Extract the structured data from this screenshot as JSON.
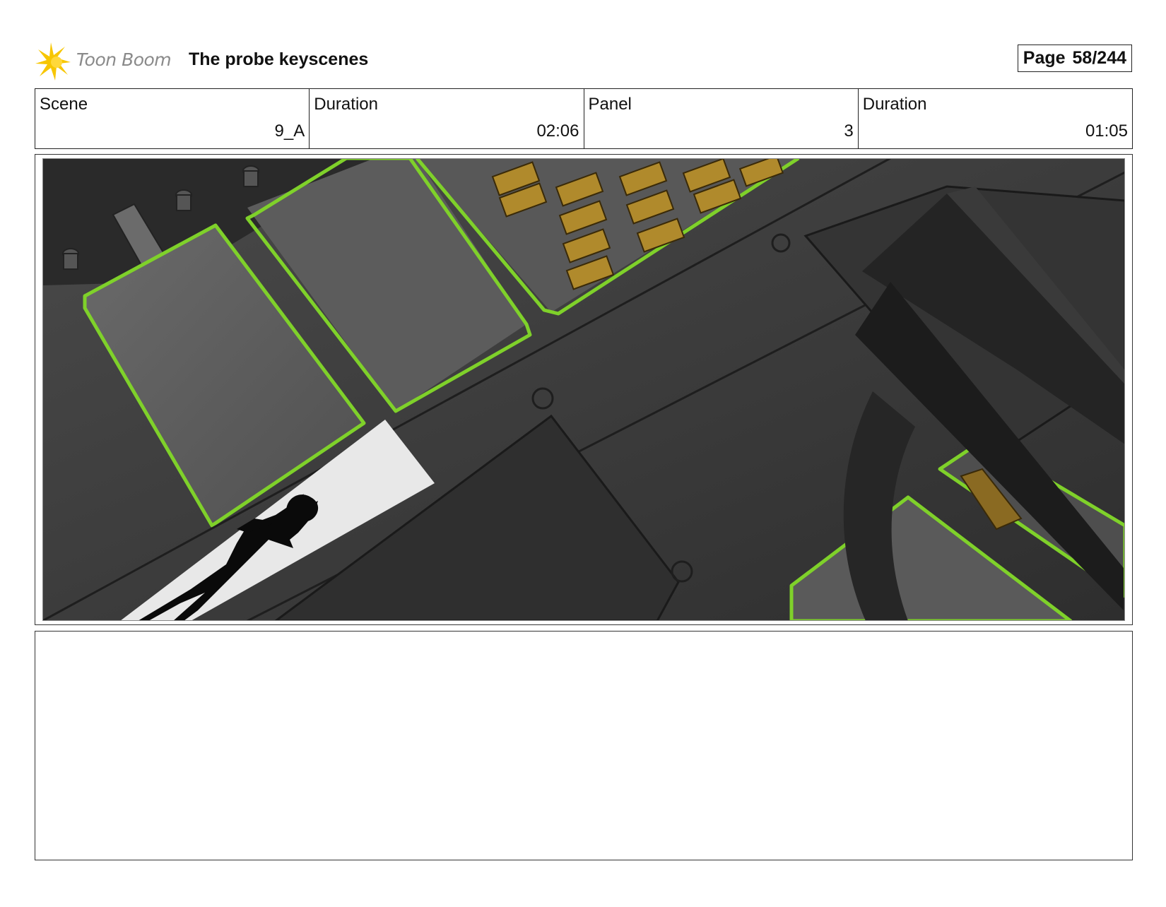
{
  "header": {
    "brand": "Toon Boom",
    "title": "The probe keyscenes",
    "page_label": "Page",
    "page_number": "58/244"
  },
  "info": {
    "scene_label": "Scene",
    "scene_value": "9_A",
    "scene_duration_label": "Duration",
    "scene_duration_value": "02:06",
    "panel_label": "Panel",
    "panel_value": "3",
    "panel_duration_label": "Duration",
    "panel_duration_value": "01:05"
  },
  "colors": {
    "accent_green": "#7fd12a",
    "floor_dark": "#3a3a3a",
    "crate_gold": "#b08a2c",
    "logo_yellow": "#f7c600"
  },
  "notes": {
    "text": ""
  }
}
